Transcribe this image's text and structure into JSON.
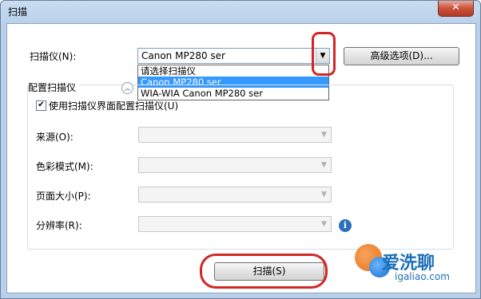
{
  "window": {
    "title": "扫描",
    "close_glyph": "✕"
  },
  "scanner": {
    "label": "扫描仪(N):",
    "selected": "Canon MP280 ser",
    "advanced_button": "高级选项(D)...",
    "options": [
      "请选择扫描仪",
      "Canon MP280 ser",
      "WIA-WIA Canon MP280 ser"
    ],
    "selected_index": 1
  },
  "config": {
    "title": "配置扫描仪",
    "use_ui_checkbox": "使用扫描仪界面配置扫描仪(U)",
    "use_ui_checked": true,
    "source_label": "来源(O):",
    "color_mode_label": "色彩模式(M):",
    "page_size_label": "页面大小(P):",
    "resolution_label": "分辨率(R):"
  },
  "actions": {
    "scan_button": "扫描(S)"
  },
  "watermark": {
    "brand": "爱洗聊",
    "url": "igaliao.com"
  },
  "colors": {
    "highlight": "#d32626",
    "selection": "#3399ff",
    "info": "#2d6fbf"
  }
}
